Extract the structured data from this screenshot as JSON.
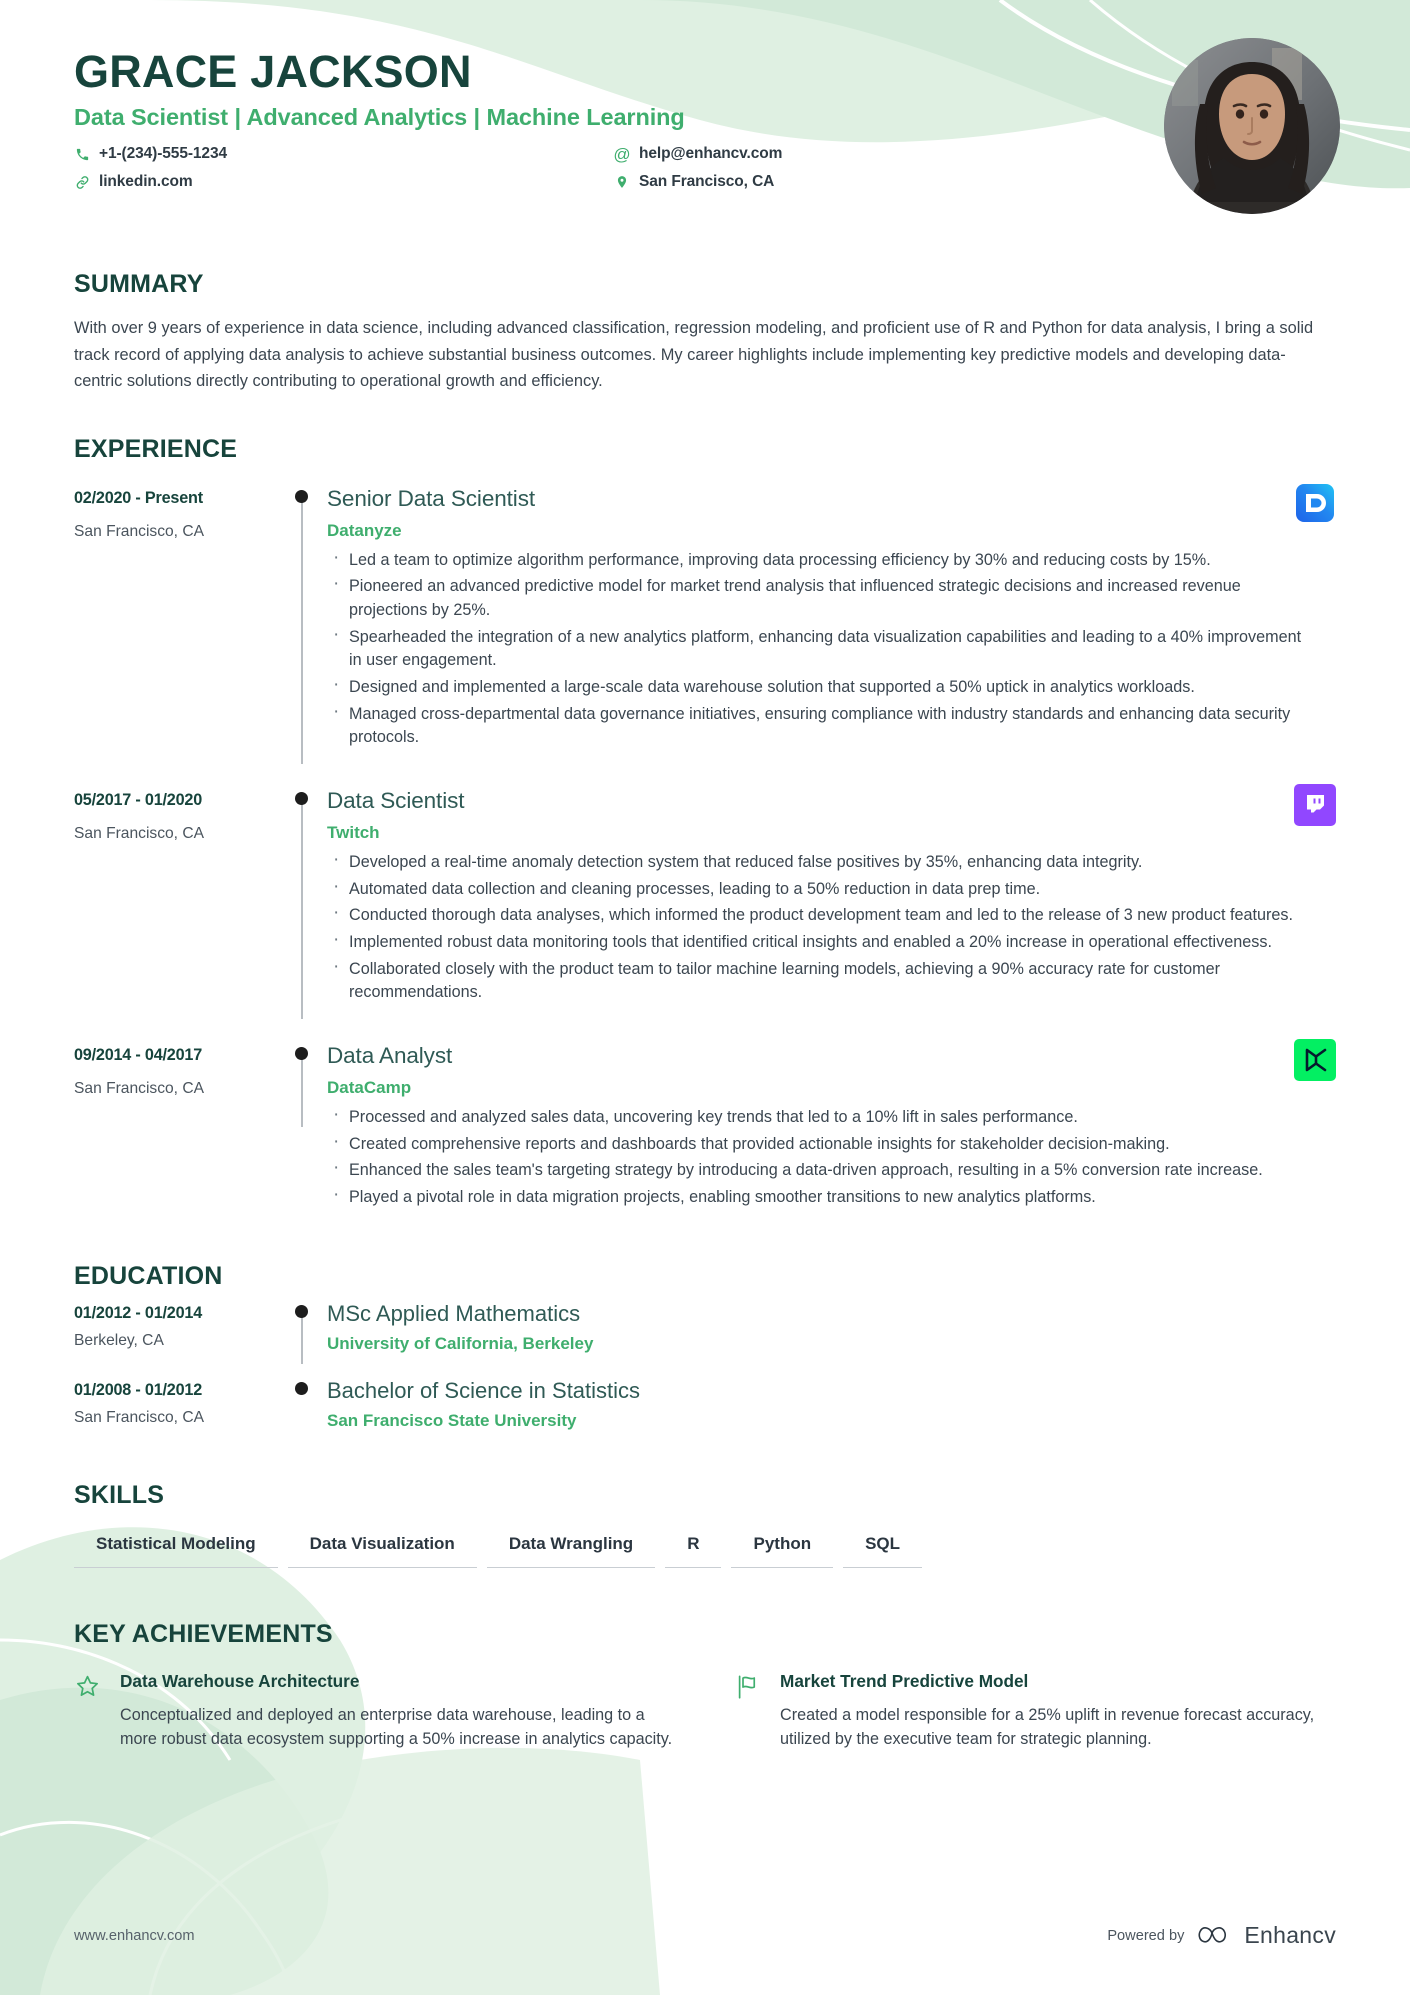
{
  "header": {
    "name": "GRACE JACKSON",
    "headline": "Data Scientist | Advanced Analytics | Machine Learning",
    "contacts": [
      {
        "icon": "phone-icon",
        "text": "+1-(234)-555-1234"
      },
      {
        "icon": "email-icon",
        "text": "help@enhancv.com"
      },
      {
        "icon": "link-icon",
        "text": "linkedin.com"
      },
      {
        "icon": "location-pin-icon",
        "text": "San Francisco, CA"
      }
    ],
    "avatar_alt": "profile-photo"
  },
  "summary": {
    "title": "SUMMARY",
    "text": "With over 9 years of experience in data science, including advanced classification, regression modeling, and proficient use of R and Python for data analysis, I bring a solid track record of applying data analysis to achieve substantial business outcomes. My career highlights include implementing key predictive models and developing data-centric solutions directly contributing to operational growth and efficiency."
  },
  "experience": {
    "title": "EXPERIENCE",
    "items": [
      {
        "date": "02/2020 - Present",
        "location": "San Francisco, CA",
        "role": "Senior Data Scientist",
        "company": "Datanyze",
        "logo": "datanyze-logo",
        "bullets": [
          "Led a team to optimize algorithm performance, improving data processing efficiency by 30% and reducing costs by 15%.",
          "Pioneered an advanced predictive model for market trend analysis that influenced strategic decisions and increased revenue projections by 25%.",
          "Spearheaded the integration of a new analytics platform, enhancing data visualization capabilities and leading to a 40% improvement in user engagement.",
          "Designed and implemented a large-scale data warehouse solution that supported a 50% uptick in analytics workloads.",
          "Managed cross-departmental data governance initiatives, ensuring compliance with industry standards and enhancing data security protocols."
        ]
      },
      {
        "date": "05/2017 - 01/2020",
        "location": "San Francisco, CA",
        "role": "Data Scientist",
        "company": "Twitch",
        "logo": "twitch-logo",
        "bullets": [
          "Developed a real-time anomaly detection system that reduced false positives by 35%, enhancing data integrity.",
          "Automated data collection and cleaning processes, leading to a 50% reduction in data prep time.",
          "Conducted thorough data analyses, which informed the product development team and led to the release of 3 new product features.",
          "Implemented robust data monitoring tools that identified critical insights and enabled a 20% increase in operational effectiveness.",
          "Collaborated closely with the product team to tailor machine learning models, achieving a 90% accuracy rate for customer recommendations."
        ]
      },
      {
        "date": "09/2014 - 04/2017",
        "location": "San Francisco, CA",
        "role": "Data Analyst",
        "company": "DataCamp",
        "logo": "datacamp-logo",
        "bullets": [
          "Processed and analyzed sales data, uncovering key trends that led to a 10% lift in sales performance.",
          "Created comprehensive reports and dashboards that provided actionable insights for stakeholder decision-making.",
          "Enhanced the sales team's targeting strategy by introducing a data-driven approach, resulting in a 5% conversion rate increase.",
          "Played a pivotal role in data migration projects, enabling smoother transitions to new analytics platforms."
        ]
      }
    ]
  },
  "education": {
    "title": "EDUCATION",
    "items": [
      {
        "date": "01/2012 - 01/2014",
        "location": "Berkeley, CA",
        "degree": "MSc Applied Mathematics",
        "school": "University of California, Berkeley"
      },
      {
        "date": "01/2008 - 01/2012",
        "location": "San Francisco, CA",
        "degree": "Bachelor of Science in Statistics",
        "school": "San Francisco State University"
      }
    ]
  },
  "skills": {
    "title": "SKILLS",
    "items": [
      "Statistical Modeling",
      "Data Visualization",
      "Data Wrangling",
      "R",
      "Python",
      "SQL"
    ]
  },
  "achievements": {
    "title": "KEY ACHIEVEMENTS",
    "items": [
      {
        "icon": "star-icon",
        "title": "Data Warehouse Architecture",
        "desc": "Conceptualized and deployed an enterprise data warehouse, leading to a more robust data ecosystem supporting a 50% increase in analytics capacity."
      },
      {
        "icon": "flag-icon",
        "title": "Market Trend Predictive Model",
        "desc": "Created a model responsible for a 25% uplift in revenue forecast accuracy, utilized by the executive team for strategic planning."
      }
    ]
  },
  "footer": {
    "url": "www.enhancv.com",
    "powered_by": "Powered by",
    "brand": "Enhancv"
  },
  "colors": {
    "dark_green": "#17443c",
    "accent_green": "#3fae6e",
    "body_text": "#3b4650",
    "blob_green": "#dff0e2"
  }
}
